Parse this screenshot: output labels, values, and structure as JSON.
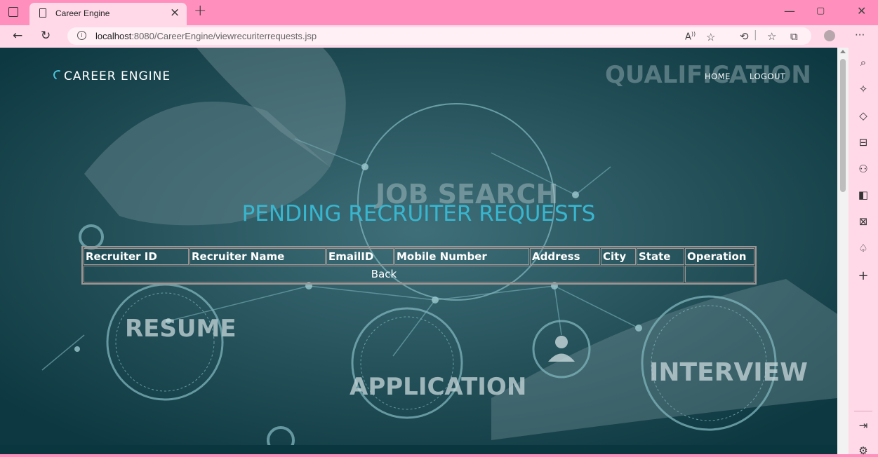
{
  "browser": {
    "tab_title": "Career Engine",
    "tab_close": "×",
    "new_tab": "+",
    "url_host": "localhost",
    "url_rest": ":8080/CareerEngine/viewrecuriterrequests.jsp",
    "read_aloud": "A",
    "icons": [
      "back-icon",
      "refresh-icon",
      "info-icon",
      "read-aloud-icon",
      "favorites-add-icon",
      "extensions-icon",
      "favorites-icon",
      "collections-icon",
      "profile-icon",
      "more-icon"
    ]
  },
  "page": {
    "brand": "CAREER ENGINE",
    "nav": {
      "home": "HOME",
      "logout": "LOGOUT"
    },
    "heading": "PENDING RECRUITER REQUESTS",
    "table": {
      "headers": [
        "Recruiter ID",
        "Recruiter Name",
        "EmailID",
        "Mobile Number",
        "Address",
        "City",
        "State",
        "Operation"
      ],
      "back_label": "Back"
    },
    "background_words": [
      "QUALIFICATION",
      "JOB SEARCH",
      "RESUME",
      "APPLICATION",
      "INTERVIEW"
    ]
  },
  "sidebar": {
    "icons": [
      "search-icon",
      "sparkle-icon",
      "tag-icon",
      "briefcase-icon",
      "people-icon",
      "office-icon",
      "outlook-icon",
      "bell-icon",
      "add-icon",
      "split-screen-icon",
      "settings-icon"
    ]
  },
  "colors": {
    "accent": "#38b6cf",
    "chrome": "#ff8fbd",
    "toolbar": "#ffd9e8",
    "page_bg": "#0f3f48"
  }
}
